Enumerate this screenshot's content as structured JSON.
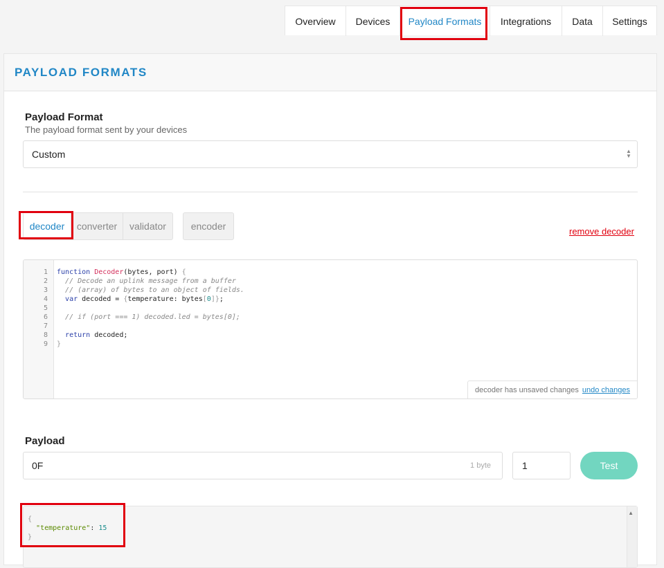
{
  "tabs": [
    "Overview",
    "Devices",
    "Payload Formats",
    "Integrations",
    "Data",
    "Settings"
  ],
  "panel": {
    "title": "PAYLOAD FORMATS"
  },
  "payload_format": {
    "label": "Payload Format",
    "help": "The payload format sent by your devices",
    "selected": "Custom"
  },
  "function_tabs": {
    "group1": [
      "decoder",
      "converter",
      "validator"
    ],
    "group2": [
      "encoder"
    ],
    "active": "decoder",
    "remove_link": "remove decoder"
  },
  "editor": {
    "line_numbers": [
      "1",
      "2",
      "3",
      "4",
      "5",
      "6",
      "7",
      "8",
      "9"
    ],
    "unsaved_text": "decoder has unsaved changes",
    "undo_link": "undo changes"
  },
  "payload": {
    "label": "Payload",
    "value": "0F",
    "byte_hint": "1 byte",
    "port": "1",
    "test_label": "Test"
  },
  "output": {
    "key": "\"temperature\"",
    "value": "15"
  },
  "colors": {
    "accent": "#2187c6",
    "highlight": "#e1000f",
    "test_button": "#72d6c0"
  },
  "icons": {
    "select_arrows": "chevron-up-down-icon",
    "scroll_up": "scroll-up-arrow-icon"
  }
}
